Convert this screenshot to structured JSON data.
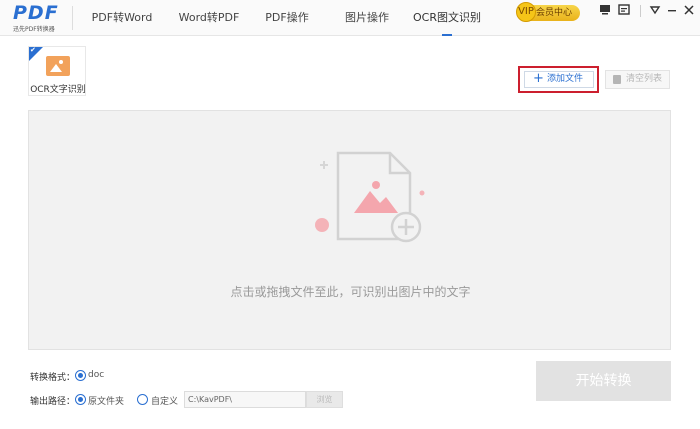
{
  "app": {
    "logo_text": "PDF",
    "logo_subtitle": "迅先PDF转换器"
  },
  "tabs": [
    {
      "label": "PDF转Word",
      "active": false
    },
    {
      "label": "Word转PDF",
      "active": false
    },
    {
      "label": "PDF操作",
      "active": false
    },
    {
      "label": "图片操作",
      "active": false
    },
    {
      "label": "OCR图文识别",
      "active": true
    }
  ],
  "vip": {
    "label": "会员中心",
    "badge": "VIP"
  },
  "window_controls": [
    "monitor-icon",
    "message-icon",
    "dropdown-icon",
    "minimize-icon",
    "close-icon"
  ],
  "toolbar": {
    "tool_card_label": "OCR文字识别",
    "add_file_label": "添加文件",
    "clear_list_label": "清空列表"
  },
  "drop_area": {
    "hint": "点击或拖拽文件至此，可识别出图片中的文字"
  },
  "options": {
    "format_label": "转换格式：",
    "format_value": "doc",
    "output_label": "输出路径：",
    "output_original": "原文件夹",
    "output_custom": "自定义",
    "output_selected": "原文件夹",
    "custom_path": "C:\\KavPDF\\",
    "browse_label": "浏览"
  },
  "start_button": "开始转换",
  "colors": {
    "accent": "#2a6fd1",
    "highlight_box": "#cc1f2e",
    "tool_icon": "#f2a25b",
    "illustration_pink": "#f4a6ad"
  }
}
